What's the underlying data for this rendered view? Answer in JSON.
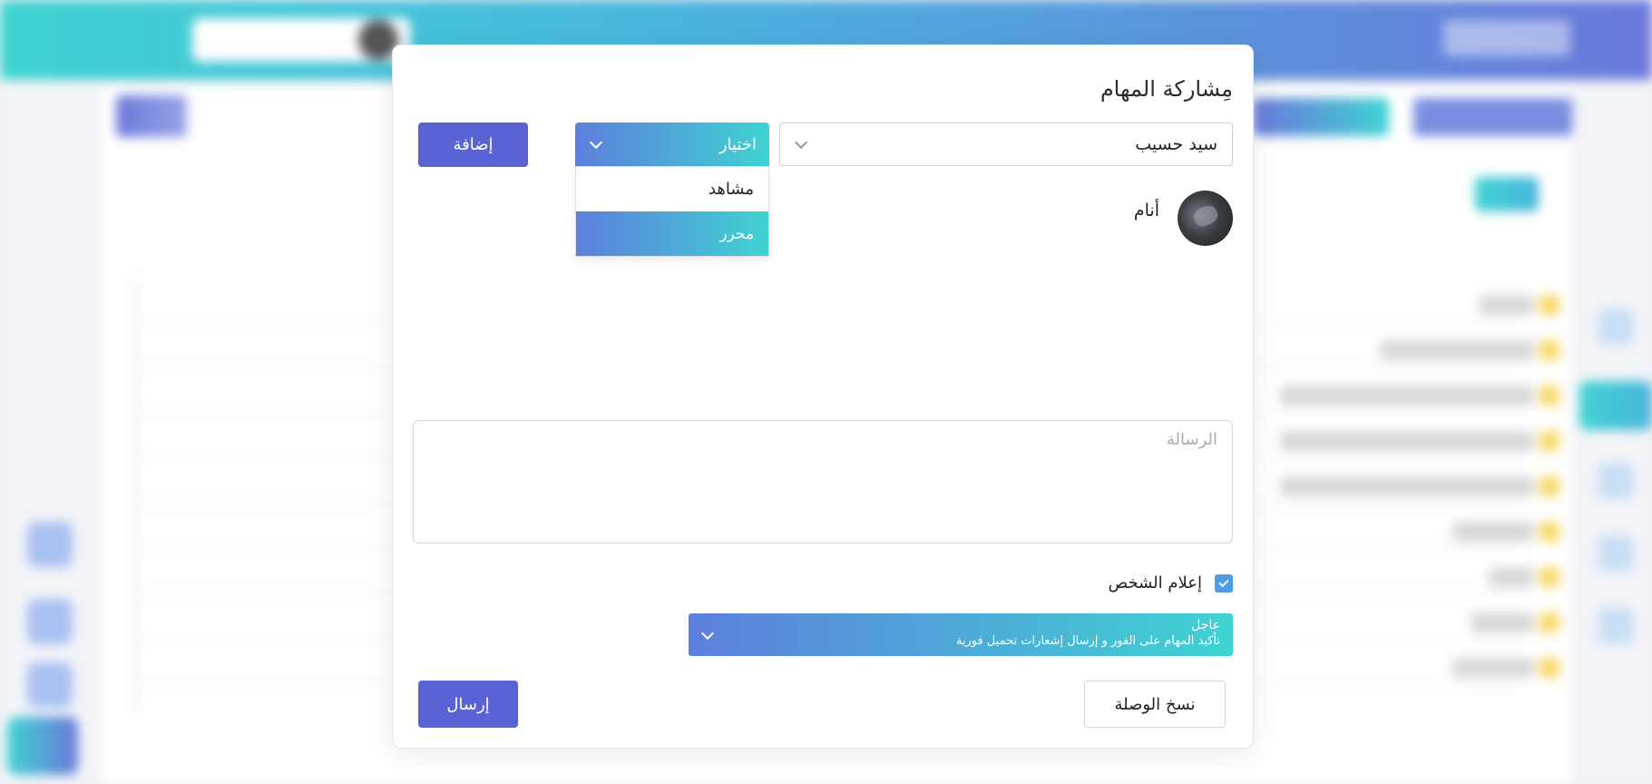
{
  "modal": {
    "title": "مِشاركة المهام",
    "user_select": {
      "value": "سيد حسيب"
    },
    "role_select": {
      "value": "اختيار",
      "options": [
        {
          "label": "مشاهد"
        },
        {
          "label": "محرر"
        }
      ],
      "highlighted": "محرر"
    },
    "add_label": "إضافة",
    "member": {
      "name": "أنام"
    },
    "message": {
      "placeholder": "الرسالة",
      "value": ""
    },
    "notify": {
      "label": "إعلام الشخص",
      "checked": true
    },
    "priority": {
      "title": "عاجل",
      "description": "تأكيد المهام على الفور و إرسال إشعارات تحميل فورية"
    },
    "copy_link_label": "نسخ الوصلة",
    "send_label": "إرسال"
  },
  "colors": {
    "primary": "#5a63d6",
    "gradient_start": "#5d7fdc",
    "gradient_end": "#3fd3d2",
    "checkbox": "#4b9de5"
  },
  "icons": {
    "dropdown": "chevron-down-icon",
    "check": "check-icon"
  }
}
